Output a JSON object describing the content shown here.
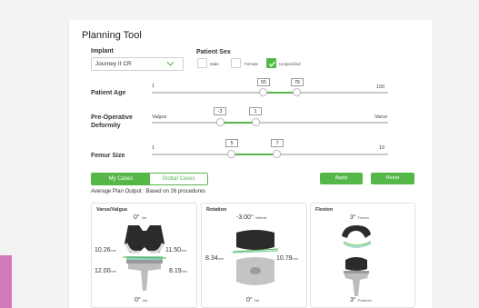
{
  "title": "Planning Tool",
  "implant": {
    "label": "Implant",
    "value": "Journey II CR"
  },
  "patient_sex": {
    "label": "Patient Sex",
    "options": [
      {
        "label": "Male",
        "checked": false
      },
      {
        "label": "Female",
        "checked": false
      },
      {
        "label": "Unspecified",
        "checked": true
      }
    ]
  },
  "sliders": {
    "age": {
      "label": "Patient Age",
      "min_label": "1",
      "max_label": "100",
      "low": "55",
      "high": "76"
    },
    "deformity": {
      "label_line1": "Pre-Operative",
      "label_line2": "Deformity",
      "min_label": "Valgus",
      "max_label": "Varus",
      "low": "-3",
      "high": "1"
    },
    "femur": {
      "label": "Femur Size",
      "min_label": "1",
      "max_label": "10",
      "low": "5",
      "high": "7"
    }
  },
  "tabs": {
    "my_cases": "My Cases",
    "global_cases": "Global Cases"
  },
  "buttons": {
    "apply": "Apply",
    "reset": "Reset"
  },
  "avg_output": "Average Plan Output : Based on 26 procedures",
  "panels": {
    "varus_valgus": {
      "title": "Varus/Valgus",
      "top_val": "0°",
      "top_unit": "Var",
      "left_top": "10.26",
      "left_top_unit": "mm",
      "right_top": "11.50",
      "right_top_unit": "mm",
      "left_bot": "12.00",
      "left_bot_unit": "mm",
      "right_bot": "8.19",
      "right_bot_unit": "mm",
      "bot_val": "0°",
      "bot_unit": "Var"
    },
    "rotation": {
      "title": "Rotation",
      "top_val": "-3.00°",
      "top_unit": "Internal",
      "left": "8.34",
      "left_unit": "mm",
      "right": "10.79",
      "right_unit": "mm",
      "bot_val": "0°",
      "bot_unit": "Val"
    },
    "flexion": {
      "title": "Flexion",
      "top_val": "3°",
      "top_unit": "Flexion",
      "bot_val": "3°",
      "bot_unit": "Posterior"
    }
  },
  "colors": {
    "accent": "#55b748",
    "side_strip": "#d27ab9"
  }
}
